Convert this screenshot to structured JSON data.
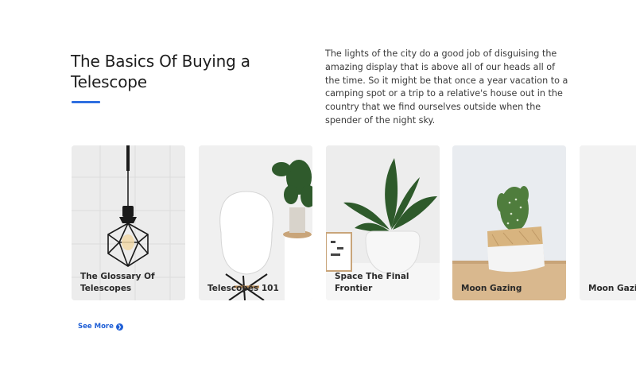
{
  "header": {
    "title": "The Basics Of Buying a Telescope",
    "description": "The lights of the city do a good job of disguising the amazing display that is above all of our heads all of the time. So it might be that once a year vacation to a camping spot or a trip to a relative's house out in the country that we find ourselves outside when the spender of the night sky.",
    "accent_color": "#2f6fe0"
  },
  "cards": [
    {
      "label_line1": "The Glossary Of",
      "label_line2": "Telescopes",
      "image": "pendant-lamp-image"
    },
    {
      "label_line1": "Telescopes 101",
      "label_line2": "",
      "image": "white-chair-image"
    },
    {
      "label_line1": "Space The Final",
      "label_line2": "Frontier",
      "image": "potted-plant-image"
    },
    {
      "label_line1": "Moon Gazing",
      "label_line2": "",
      "image": "cactus-pot-image"
    },
    {
      "label_line1": "Moon Gazing",
      "label_line2": "",
      "image": "blank-image"
    }
  ],
  "see_more": {
    "label": "See More",
    "icon": "chevron-right-icon",
    "color": "#1f5fd6"
  }
}
